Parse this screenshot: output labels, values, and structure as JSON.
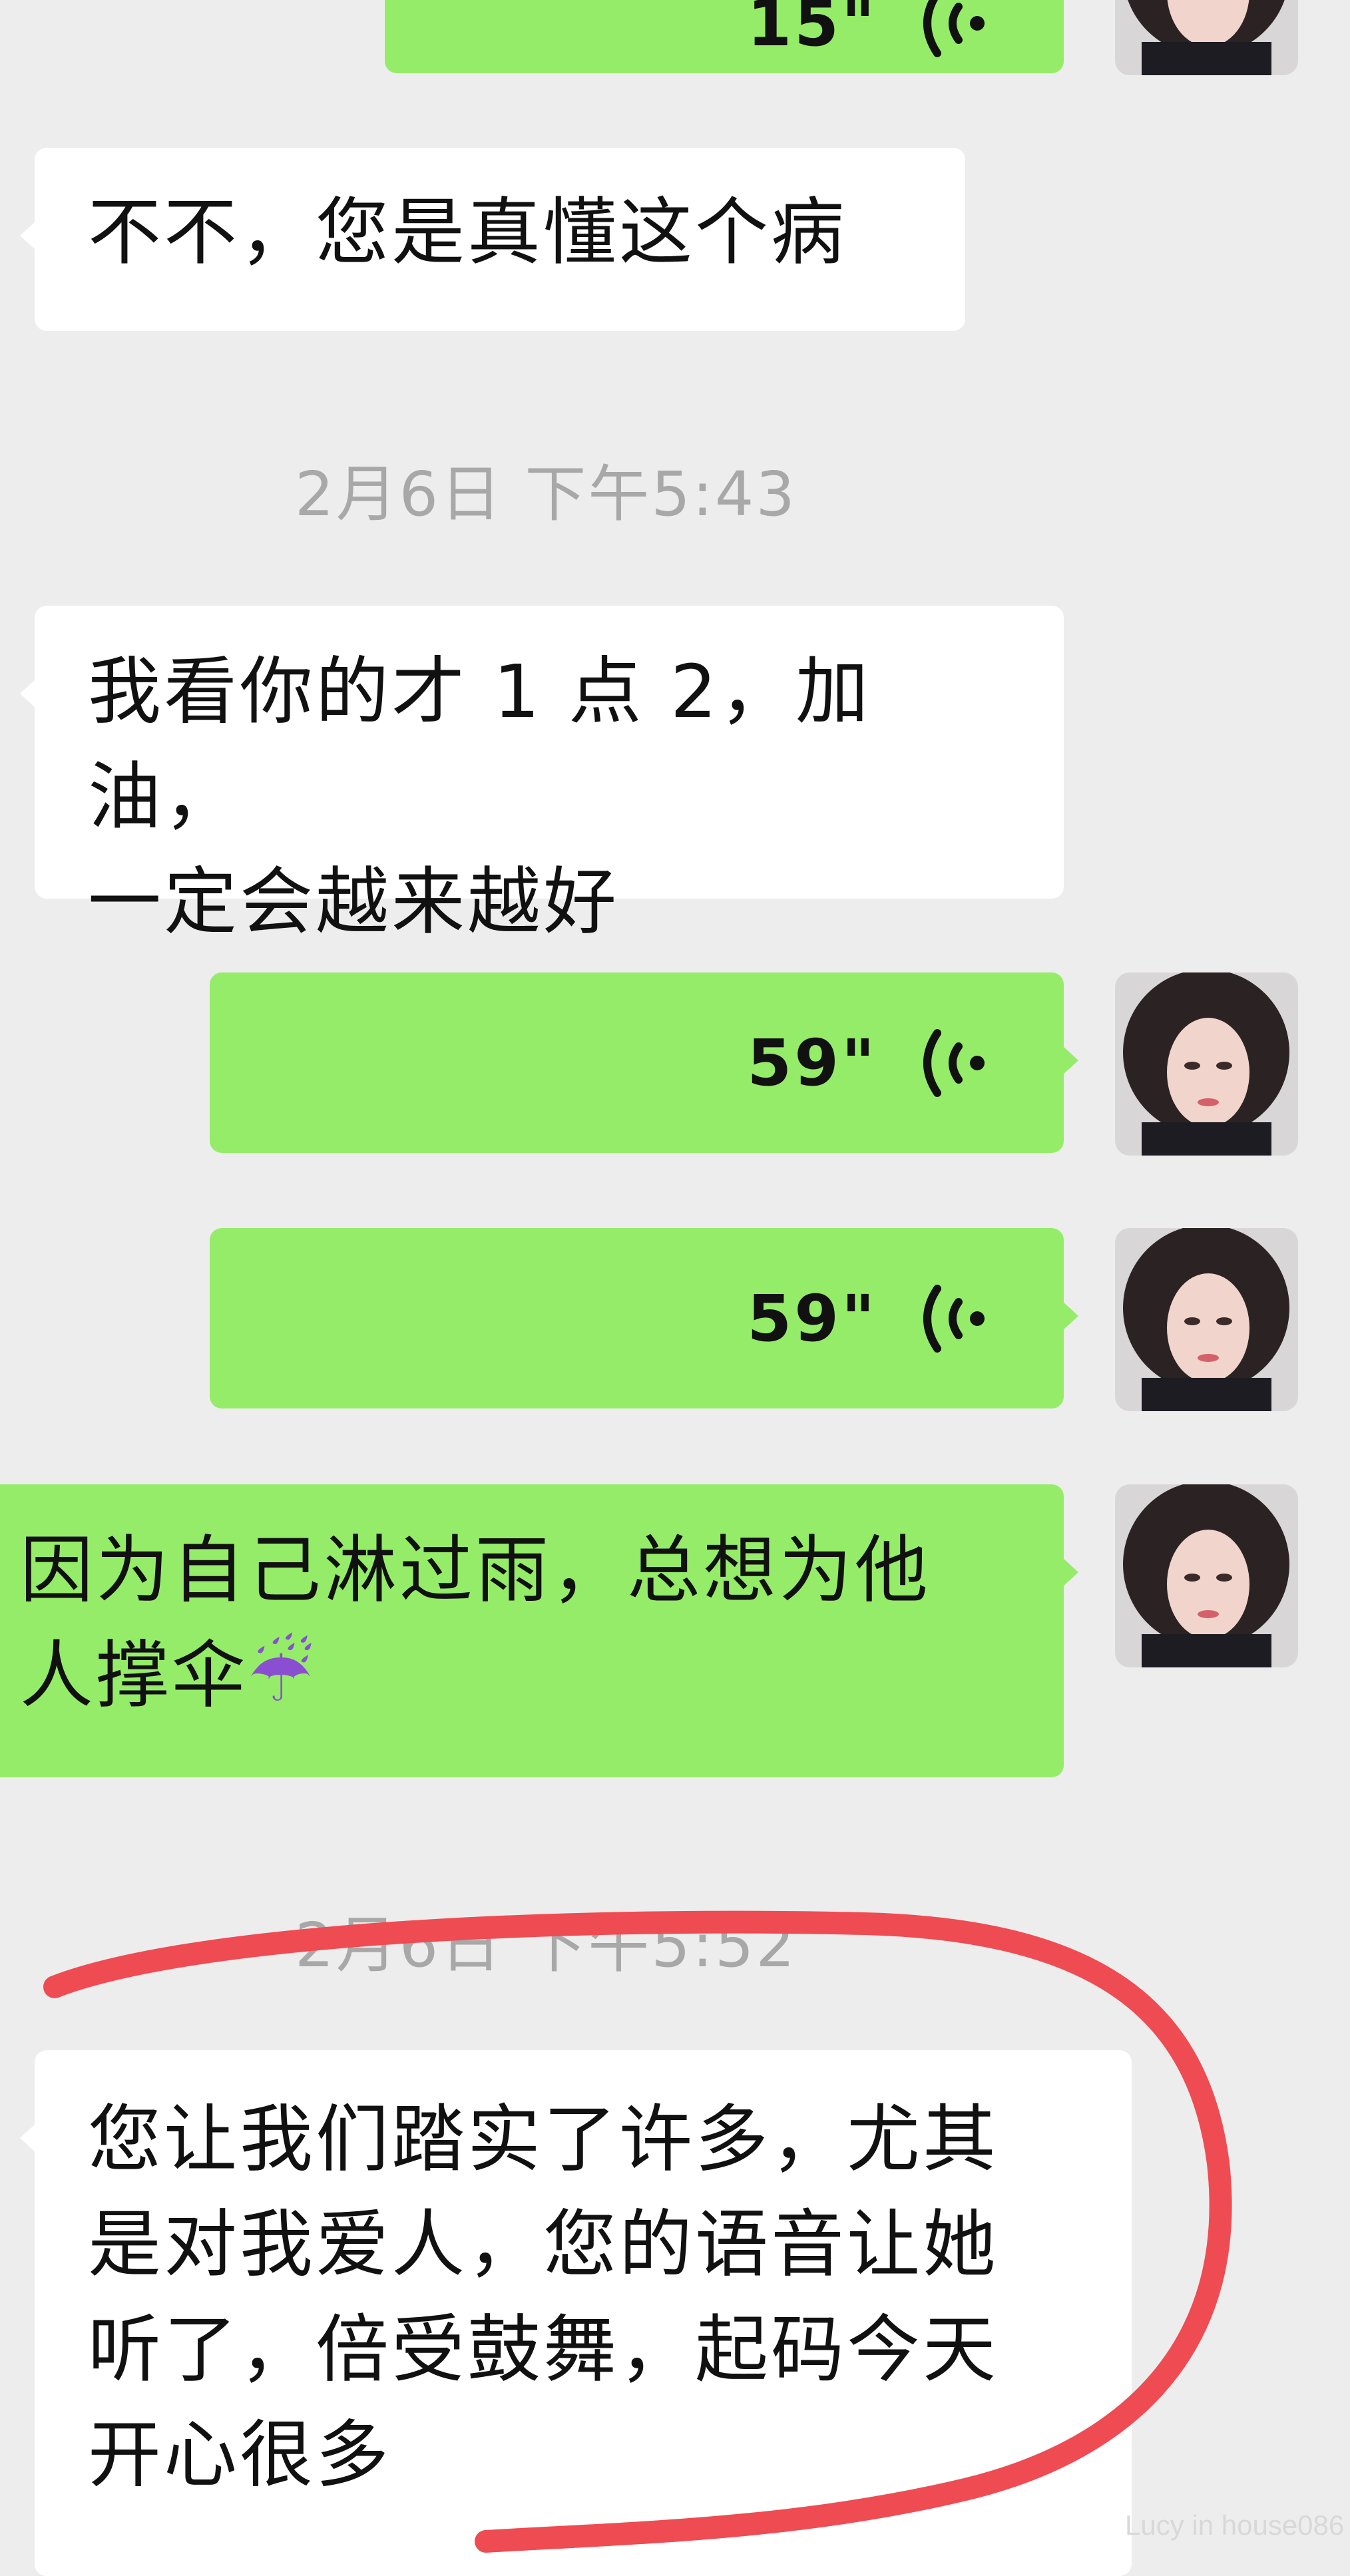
{
  "messages": {
    "m0_voice": {
      "duration": "15\"",
      "direction": "out"
    },
    "m1": {
      "lines": [
        "不不，您是真懂这个病"
      ],
      "direction": "in"
    },
    "time1": "2月6日 下午5:43",
    "m2": {
      "lines": [
        "我看你的才 1 点 2，加油，",
        "一定会越来越好"
      ],
      "direction": "in"
    },
    "m3_voice": {
      "duration": "59\"",
      "direction": "out"
    },
    "m4_voice": {
      "duration": "59\"",
      "direction": "out"
    },
    "m5": {
      "lines": [
        "因为自己淋过雨，总想为他",
        "人撑伞"
      ],
      "emoji": "☔",
      "direction": "out"
    },
    "time2": "2月6日 下午5:52",
    "m6": {
      "lines": [
        "您让我们踏实了许多，尤其",
        "是对我爱人，您的语音让她",
        "听了，倍受鼓舞，起码今天",
        "开心很多"
      ],
      "direction": "in"
    }
  },
  "watermark": "Lucy in house086",
  "colors": {
    "background": "#ededed",
    "incoming": "#ffffff",
    "outgoing": "#95ec69",
    "timestamp": "#a8a8a8",
    "annotation": "#ef4b52"
  }
}
